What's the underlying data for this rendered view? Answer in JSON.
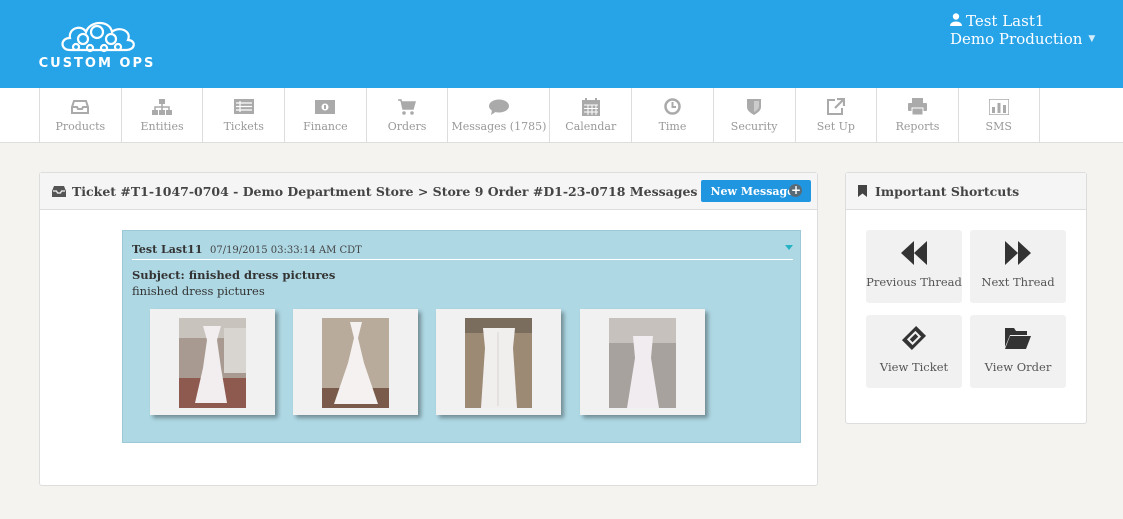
{
  "header": {
    "logo_text": "CUSTOM OPS",
    "user_name": "Test Last1",
    "user_org": "Demo Production"
  },
  "nav": {
    "items": [
      {
        "label": "Products",
        "icon": "inbox-icon"
      },
      {
        "label": "Entities",
        "icon": "sitemap-icon"
      },
      {
        "label": "Tickets",
        "icon": "list-icon"
      },
      {
        "label": "Finance",
        "icon": "money-icon"
      },
      {
        "label": "Orders",
        "icon": "cart-icon"
      },
      {
        "label": "Messages (1785)",
        "icon": "comment-icon"
      },
      {
        "label": "Calendar",
        "icon": "calendar-icon"
      },
      {
        "label": "Time",
        "icon": "clock-icon"
      },
      {
        "label": "Security",
        "icon": "shield-icon"
      },
      {
        "label": "Set Up",
        "icon": "external-link-icon"
      },
      {
        "label": "Reports",
        "icon": "print-icon"
      },
      {
        "label": "SMS",
        "icon": "bar-chart-icon"
      }
    ]
  },
  "panel": {
    "title": "Ticket #T1-1047-0704 - Demo Department Store > Store 9 Order #D1-23-0718 Messages",
    "new_message_label": "New Message"
  },
  "message": {
    "author": "Test Last11",
    "timestamp": "07/19/2015 03:33:14 AM CDT",
    "subject": "Subject: finished dress pictures",
    "body": "finished dress pictures",
    "attachments": [
      "dress-photo-1",
      "dress-photo-2",
      "dress-photo-3",
      "dress-photo-4"
    ]
  },
  "shortcuts": {
    "title": "Important Shortcuts",
    "buttons": [
      {
        "label": "Previous Thread",
        "icon": "backward-icon"
      },
      {
        "label": "Next Thread",
        "icon": "forward-icon"
      },
      {
        "label": "View Ticket",
        "icon": "ticket-icon"
      },
      {
        "label": "View Order",
        "icon": "folder-open-icon"
      }
    ]
  },
  "colors": {
    "header_bg": "#27a3e8",
    "message_bg": "#aed8e4",
    "button_blue": "#2196e0"
  }
}
